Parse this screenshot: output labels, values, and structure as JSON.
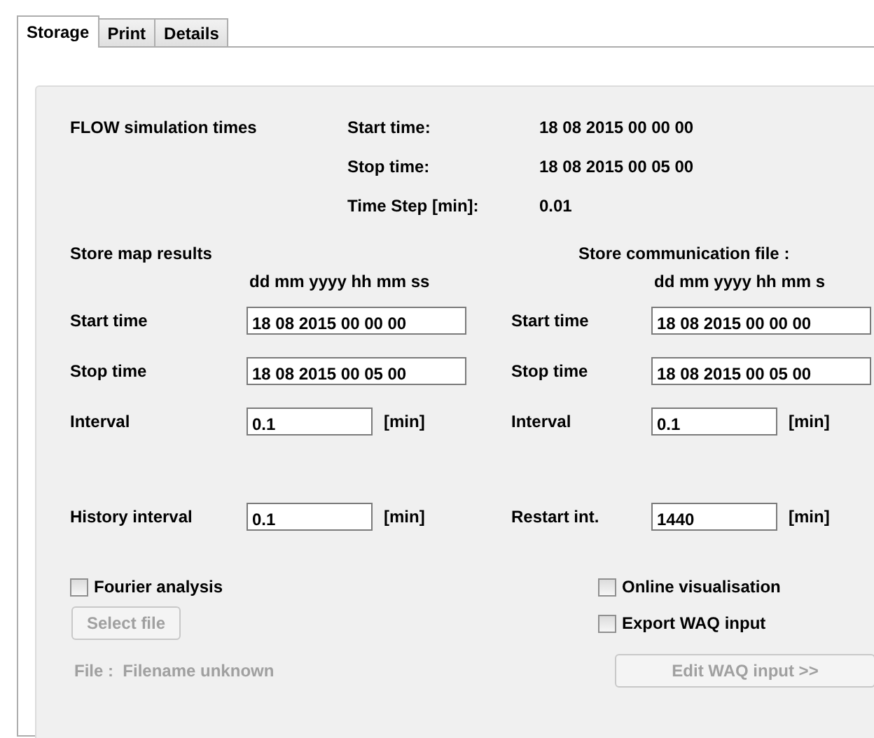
{
  "tabs": [
    {
      "label": "Storage",
      "selected": true
    },
    {
      "label": "Print",
      "selected": false
    },
    {
      "label": "Details",
      "selected": false
    }
  ],
  "flow": {
    "label": "FLOW simulation times",
    "rows": [
      {
        "label": "Start time:",
        "value": "18 08 2015 00 00 00"
      },
      {
        "label": "Stop time:",
        "value": "18 08 2015 00 05 00"
      },
      {
        "label": "Time Step [min]:",
        "value": "0.01"
      }
    ]
  },
  "map": {
    "title": "Store map results",
    "format": "dd mm yyyy hh mm ss",
    "start": {
      "label": "Start time",
      "value": "18 08 2015 00 00 00"
    },
    "stop": {
      "label": "Stop time",
      "value": "18 08 2015 00 05 00"
    },
    "interval": {
      "label": "Interval",
      "value": "0.1",
      "unit": "[min]"
    }
  },
  "comm": {
    "title": "Store communication file :",
    "format": "dd mm yyyy hh mm s",
    "start": {
      "label": "Start time",
      "value": "18 08 2015 00 00 00"
    },
    "stop": {
      "label": "Stop time",
      "value": "18 08 2015 00 05 00"
    },
    "interval": {
      "label": "Interval",
      "value": "0.1",
      "unit": "[min]"
    }
  },
  "history": {
    "label": "History interval",
    "value": "0.1",
    "unit": "[min]"
  },
  "restart": {
    "label": "Restart int.",
    "value": "1440",
    "unit": "[min]"
  },
  "fourier": {
    "label": "Fourier analysis",
    "checked": false
  },
  "select_file": {
    "label": "Select file",
    "disabled": true
  },
  "file": {
    "text": "File :  Filename unknown",
    "disabled": true
  },
  "online": {
    "label": "Online visualisation",
    "checked": false
  },
  "export": {
    "label": "Export WAQ input",
    "checked": false
  },
  "edit_waq": {
    "label": "Edit WAQ input >>",
    "disabled": true
  }
}
